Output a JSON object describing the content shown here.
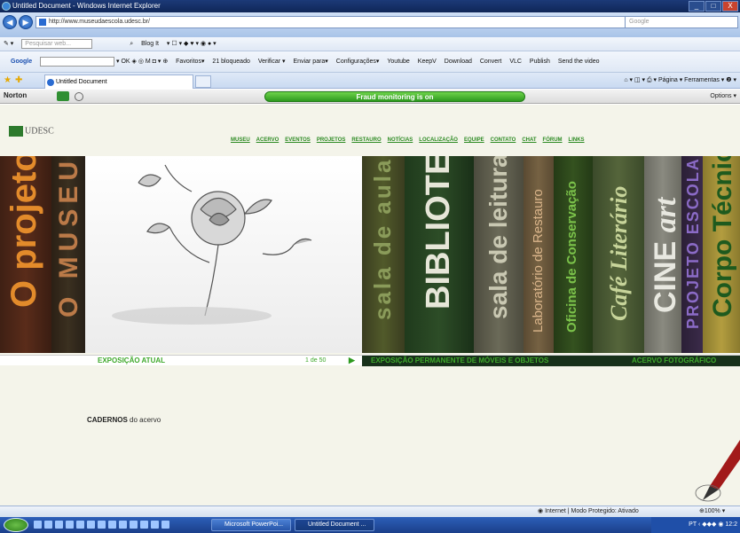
{
  "window": {
    "title": "Untitled Document - Windows Internet Explorer",
    "controls": [
      "_",
      "□",
      "X"
    ]
  },
  "address": {
    "url": "http://www.museudaescola.udesc.br/",
    "search_placeholder": "Google"
  },
  "toolbar1": {
    "search_placeholder": "Pesquisar web...",
    "blogit": "Blog It"
  },
  "toolbar2": {
    "google": "Google",
    "items": [
      "Favoritos▾",
      "21 bloqueado",
      "Verificar ▾",
      "Enviar para▾",
      "Configurações▾",
      "Youtube",
      "KeepV",
      "Download",
      "Convert",
      "VLC",
      "Publish",
      "Send the video"
    ]
  },
  "tabs": {
    "active": "Untitled Document",
    "commands": "Página ▾   Ferramentas ▾"
  },
  "norton": {
    "logo": "Norton",
    "fraud": "Fraud monitoring is on",
    "options": "Options ▾"
  },
  "site": {
    "logo": "UDESC",
    "menu": [
      "MUSEU",
      "ACERVO",
      "EVENTOS",
      "PROJETOS",
      "RESTAURO",
      "NOTÍCIAS",
      "LOCALIZAÇÃO",
      "EQUIPE",
      "CONTATO",
      "CHAT",
      "FÓRUM",
      "LINKS"
    ],
    "spines": {
      "o_projeto": "O projeto",
      "o_museu": "O MUSEU",
      "sala_aula": "sala de aula",
      "biblioteca": "BIBLIOTECA",
      "sala_leitura": "sala de leitura",
      "laboratorio": "Laboratório de Restauro",
      "oficina": "Oficina de Conservação",
      "cafe": "Café Literário",
      "cine": "CINE",
      "cine_art": "art",
      "projeto_escola": "PROJETO ESCOLA",
      "corpo_tecnico": "Corpo Técnico"
    },
    "strip": {
      "exposicao_atual": "EXPOSIÇÃO ATUAL",
      "counter": "1 de 50",
      "next": "▶",
      "permanente": "EXPOSIÇÃO PERMANENTE DE MÓVEIS E OBJETOS",
      "fotografico": "ACERVO FOTOGRÁFICO"
    },
    "cadernos_bold": "CADERNOS",
    "cadernos_rest": " do acervo"
  },
  "status": {
    "zone": "Internet | Modo Protegido: Ativado",
    "zoom": "100%"
  },
  "taskbar": {
    "task1": "Microsoft PowerPoi...",
    "task2": "Untitled Document ...",
    "lang": "PT",
    "time": "12:2"
  }
}
